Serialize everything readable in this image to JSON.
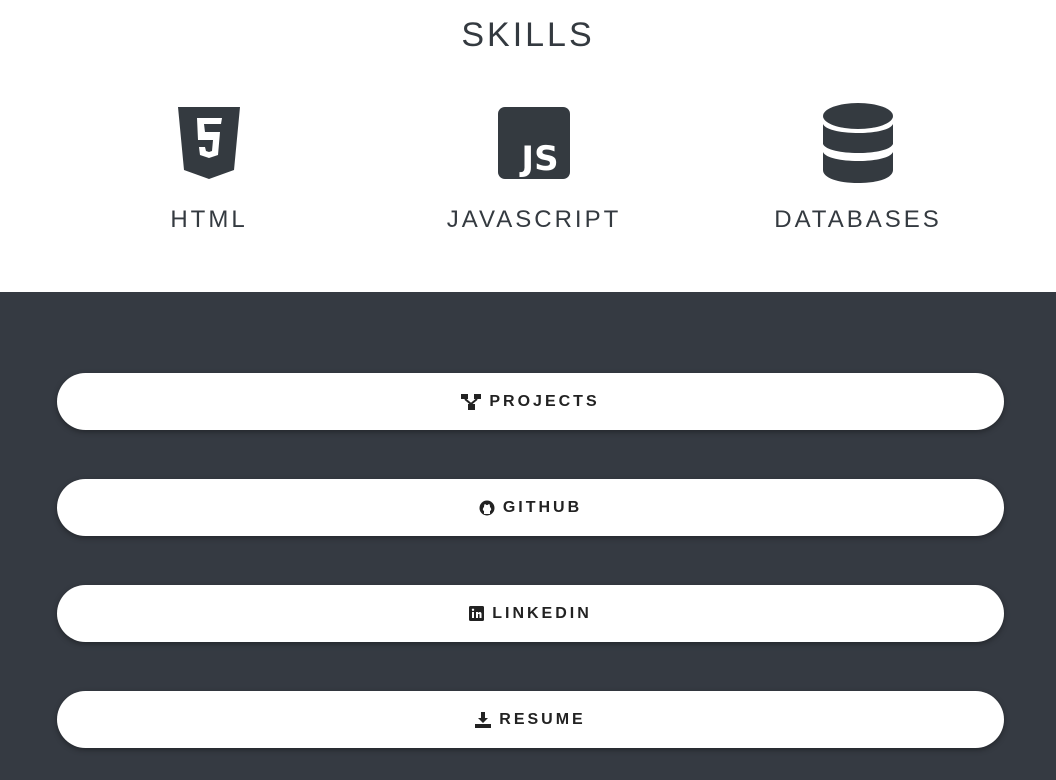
{
  "skills": {
    "title": "SKILLS",
    "items": [
      {
        "label": "HTML",
        "icon": "html5-icon"
      },
      {
        "label": "JAVASCRIPT",
        "icon": "js-icon"
      },
      {
        "label": "DATABASES",
        "icon": "database-icon"
      }
    ]
  },
  "links": [
    {
      "label": "PROJECTS",
      "icon": "sitemap-icon"
    },
    {
      "label": "GITHUB",
      "icon": "github-icon"
    },
    {
      "label": "LINKEDIN",
      "icon": "linkedin-icon"
    },
    {
      "label": "RESUME",
      "icon": "download-icon"
    }
  ],
  "colors": {
    "dark": "#353a42",
    "text": "#343a40",
    "button_bg": "#ffffff"
  }
}
